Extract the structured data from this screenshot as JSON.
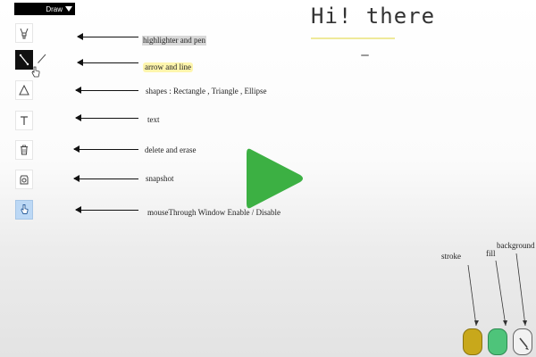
{
  "topbar": {
    "label": "Draw",
    "dropdown_icon": "caret-down-icon"
  },
  "toolbar": {
    "tools": [
      {
        "id": "highlighter",
        "icon": "highlighter-icon",
        "state": "normal"
      },
      {
        "id": "line",
        "icon": "line-icon",
        "state": "selected"
      },
      {
        "id": "shapes",
        "icon": "triangle-icon",
        "state": "normal"
      },
      {
        "id": "text",
        "icon": "text-icon",
        "state": "normal"
      },
      {
        "id": "delete",
        "icon": "trash-icon",
        "state": "normal"
      },
      {
        "id": "snapshot",
        "icon": "camera-icon",
        "state": "normal"
      },
      {
        "id": "mousethrough",
        "icon": "hand-pointer-icon",
        "state": "active"
      }
    ],
    "sub_icon": "pen-icon",
    "cursor_icon": "hand-cursor-icon"
  },
  "annotations": {
    "highlighter": "highlighter and pen",
    "arrow_line": "arrow and line",
    "shapes": "shapes : Rectangle , Triangle , Ellipse",
    "text": "text",
    "delete": "delete and erase",
    "snapshot": "snapshot",
    "mousethrough": "mouseThrough Window Enable / Disable"
  },
  "canvas": {
    "greeting": "Hi! there"
  },
  "video": {
    "play_icon": "play-icon",
    "accent_color": "#3cb043"
  },
  "colors": {
    "stroke_label": "stroke",
    "fill_label": "fill",
    "background_label": "background",
    "stroke_color": "#c8a81b",
    "fill_color": "#4ec47a",
    "background_color": "#f2f2f2",
    "background_icon": "pencil-icon"
  }
}
